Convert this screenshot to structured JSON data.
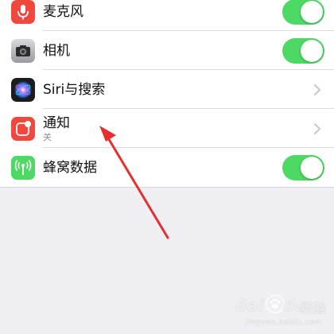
{
  "settings": {
    "rows": [
      {
        "label": "麦克风",
        "icon": "microphone-icon",
        "icon_color": "#f0483e",
        "control": "toggle",
        "on": true
      },
      {
        "label": "相机",
        "icon": "camera-icon",
        "icon_color": "#8e8e93",
        "control": "toggle",
        "on": true
      },
      {
        "label": "Siri与搜索",
        "icon": "siri-icon",
        "icon_color": "#1c1c1e",
        "control": "chevron"
      },
      {
        "label": "通知",
        "sublabel": "关",
        "icon": "notification-icon",
        "icon_color": "#f0483e",
        "control": "chevron"
      },
      {
        "label": "蜂窝数据",
        "icon": "cellular-antenna-icon",
        "icon_color": "#4cd964",
        "control": "toggle",
        "on": true
      }
    ]
  },
  "colors": {
    "toggle_on": "#4cd964",
    "annotation_arrow": "#e63030",
    "background": "#efeff4"
  },
  "watermark": {
    "brand_part1": "Bai",
    "brand_part2": "du",
    "suffix": "经验",
    "url": "jingyan.baidu.com"
  }
}
